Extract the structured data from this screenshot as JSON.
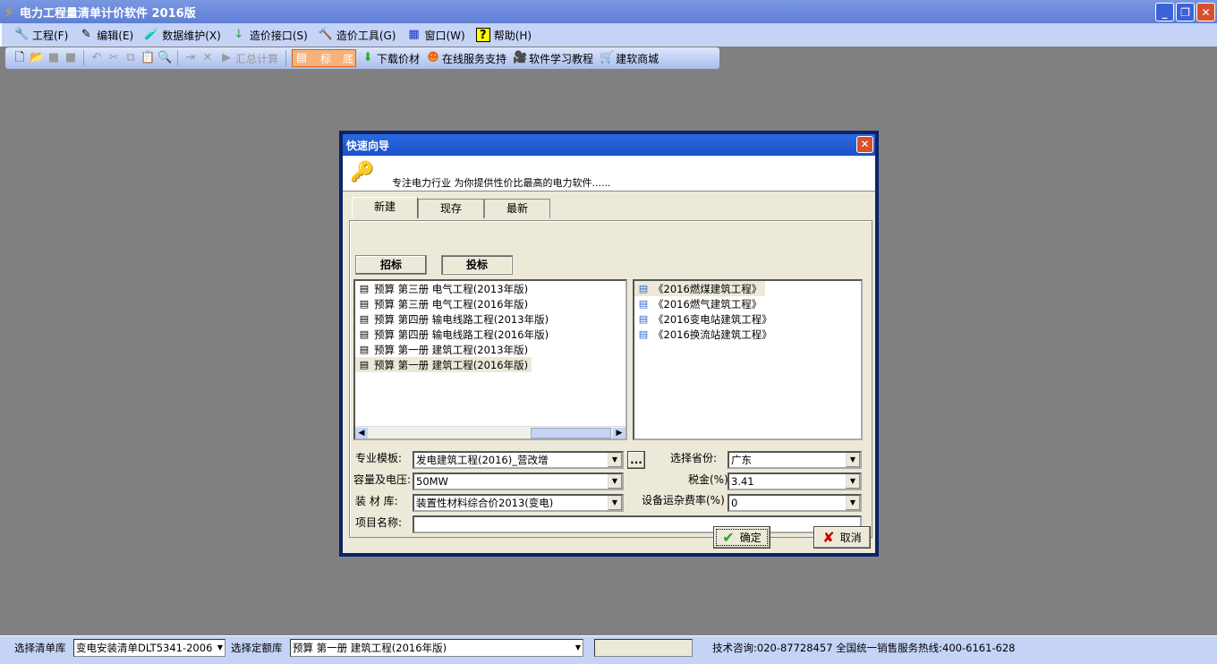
{
  "app": {
    "title": "电力工程量清单计价软件 2016版"
  },
  "menu": [
    {
      "label": "工程(F)",
      "icon": "project-icon"
    },
    {
      "label": "编辑(E)",
      "icon": "edit-icon"
    },
    {
      "label": "数据维护(X)",
      "icon": "data-icon"
    },
    {
      "label": "造价接口(S)",
      "icon": "arrow-icon"
    },
    {
      "label": "造价工具(G)",
      "icon": "tool-icon"
    },
    {
      "label": "窗口(W)",
      "icon": "window-icon"
    },
    {
      "label": "帮助(H)",
      "icon": "help-icon"
    }
  ],
  "toolbar": {
    "summary": "汇总计算",
    "bid_left": "标",
    "bid_right": "底",
    "download": "下载价材",
    "online": "在线服务支持",
    "tutorial": "软件学习教程",
    "shop": "建软商城"
  },
  "dialog": {
    "title": "快速向导",
    "slogan": "专注电力行业 为你提供性价比最高的电力软件......",
    "tabs": [
      "新建",
      "现存",
      "最新"
    ],
    "sub_buttons": [
      "招标",
      "投标"
    ],
    "left_list": [
      "预算 第三册 电气工程(2013年版)",
      "预算 第三册 电气工程(2016年版)",
      "预算 第四册 输电线路工程(2013年版)",
      "预算 第四册 输电线路工程(2016年版)",
      "预算 第一册 建筑工程(2013年版)",
      "预算 第一册 建筑工程(2016年版)"
    ],
    "right_list": [
      "《2016燃煤建筑工程》",
      "《2016燃气建筑工程》",
      "《2016变电站建筑工程》",
      "《2016换流站建筑工程》"
    ],
    "form": {
      "template_label": "专业模板:",
      "template_value": "发电建筑工程(2016)_营改增",
      "more": "...",
      "province_label": "选择省份:",
      "province_value": "广东",
      "capacity_label": "容量及电压:",
      "capacity_value": "50MW",
      "tax_label": "税金(%)",
      "tax_value": "3.41",
      "material_label": "装 材 库:",
      "material_value": "装置性材料综合价2013(变电)",
      "freight_label": "设备运杂费率(%)",
      "freight_value": "0",
      "project_label": "项目名称:",
      "project_value": ""
    },
    "ok": "确定",
    "cancel": "取消"
  },
  "status": {
    "list_label": "选择清单库",
    "list_value": "变电安装清单DLT5341-2006",
    "quota_label": "选择定额库",
    "quota_value": "预算 第一册 建筑工程(2016年版)",
    "contact": "技术咨询:020-87728457 全国统一销售服务热线:400-6161-628"
  }
}
